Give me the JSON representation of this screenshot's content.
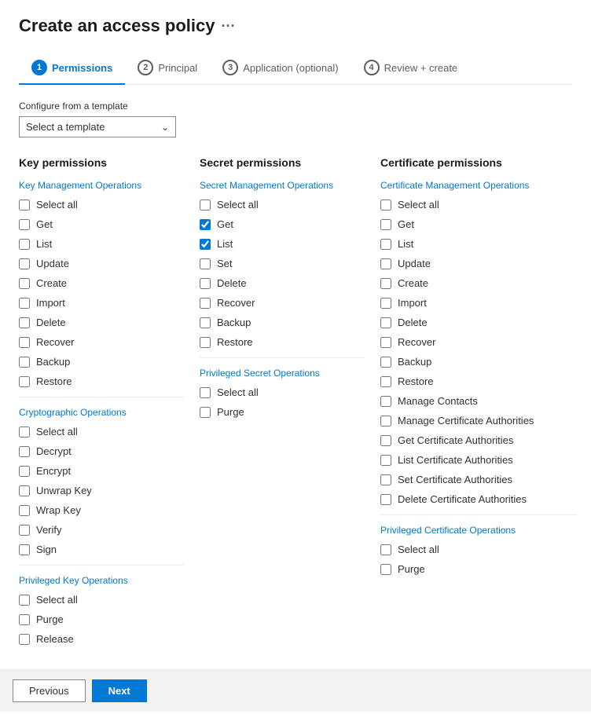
{
  "page": {
    "title": "Create an access policy",
    "title_ellipsis": "···"
  },
  "wizard": {
    "tabs": [
      {
        "id": "permissions",
        "step": "1",
        "label": "Permissions",
        "active": true
      },
      {
        "id": "principal",
        "step": "2",
        "label": "Principal",
        "active": false
      },
      {
        "id": "application",
        "step": "3",
        "label": "Application (optional)",
        "active": false
      },
      {
        "id": "review",
        "step": "4",
        "label": "Review + create",
        "active": false
      }
    ]
  },
  "template": {
    "label": "Configure from a template",
    "placeholder": "Select a template",
    "value": ""
  },
  "key_permissions": {
    "header": "Key permissions",
    "sections": [
      {
        "title": "Key Management Operations",
        "items": [
          {
            "id": "key-select-all",
            "label": "Select all",
            "checked": false
          },
          {
            "id": "key-get",
            "label": "Get",
            "checked": false
          },
          {
            "id": "key-list",
            "label": "List",
            "checked": false
          },
          {
            "id": "key-update",
            "label": "Update",
            "checked": false
          },
          {
            "id": "key-create",
            "label": "Create",
            "checked": false
          },
          {
            "id": "key-import",
            "label": "Import",
            "checked": false
          },
          {
            "id": "key-delete",
            "label": "Delete",
            "checked": false
          },
          {
            "id": "key-recover",
            "label": "Recover",
            "checked": false
          },
          {
            "id": "key-backup",
            "label": "Backup",
            "checked": false
          },
          {
            "id": "key-restore",
            "label": "Restore",
            "checked": false
          }
        ]
      },
      {
        "title": "Cryptographic Operations",
        "items": [
          {
            "id": "key-crypto-select-all",
            "label": "Select all",
            "checked": false
          },
          {
            "id": "key-decrypt",
            "label": "Decrypt",
            "checked": false
          },
          {
            "id": "key-encrypt",
            "label": "Encrypt",
            "checked": false
          },
          {
            "id": "key-unwrap",
            "label": "Unwrap Key",
            "checked": false
          },
          {
            "id": "key-wrap",
            "label": "Wrap Key",
            "checked": false
          },
          {
            "id": "key-verify",
            "label": "Verify",
            "checked": false
          },
          {
            "id": "key-sign",
            "label": "Sign",
            "checked": false
          }
        ]
      },
      {
        "title": "Privileged Key Operations",
        "items": [
          {
            "id": "key-priv-select-all",
            "label": "Select all",
            "checked": false
          },
          {
            "id": "key-purge",
            "label": "Purge",
            "checked": false
          },
          {
            "id": "key-release",
            "label": "Release",
            "checked": false
          }
        ]
      }
    ]
  },
  "secret_permissions": {
    "header": "Secret permissions",
    "sections": [
      {
        "title": "Secret Management Operations",
        "items": [
          {
            "id": "sec-select-all",
            "label": "Select all",
            "checked": false
          },
          {
            "id": "sec-get",
            "label": "Get",
            "checked": true
          },
          {
            "id": "sec-list",
            "label": "List",
            "checked": true
          },
          {
            "id": "sec-set",
            "label": "Set",
            "checked": false
          },
          {
            "id": "sec-delete",
            "label": "Delete",
            "checked": false
          },
          {
            "id": "sec-recover",
            "label": "Recover",
            "checked": false
          },
          {
            "id": "sec-backup",
            "label": "Backup",
            "checked": false
          },
          {
            "id": "sec-restore",
            "label": "Restore",
            "checked": false
          }
        ]
      },
      {
        "title": "Privileged Secret Operations",
        "items": [
          {
            "id": "sec-priv-select-all",
            "label": "Select all",
            "checked": false
          },
          {
            "id": "sec-purge",
            "label": "Purge",
            "checked": false
          }
        ]
      }
    ]
  },
  "certificate_permissions": {
    "header": "Certificate permissions",
    "sections": [
      {
        "title": "Certificate Management Operations",
        "items": [
          {
            "id": "cert-select-all",
            "label": "Select all",
            "checked": false
          },
          {
            "id": "cert-get",
            "label": "Get",
            "checked": false
          },
          {
            "id": "cert-list",
            "label": "List",
            "checked": false
          },
          {
            "id": "cert-update",
            "label": "Update",
            "checked": false
          },
          {
            "id": "cert-create",
            "label": "Create",
            "checked": false
          },
          {
            "id": "cert-import",
            "label": "Import",
            "checked": false
          },
          {
            "id": "cert-delete",
            "label": "Delete",
            "checked": false
          },
          {
            "id": "cert-recover",
            "label": "Recover",
            "checked": false
          },
          {
            "id": "cert-backup",
            "label": "Backup",
            "checked": false
          },
          {
            "id": "cert-restore",
            "label": "Restore",
            "checked": false
          },
          {
            "id": "cert-manage-contacts",
            "label": "Manage Contacts",
            "checked": false
          },
          {
            "id": "cert-manage-ca",
            "label": "Manage Certificate Authorities",
            "checked": false
          },
          {
            "id": "cert-get-ca",
            "label": "Get Certificate Authorities",
            "checked": false
          },
          {
            "id": "cert-list-ca",
            "label": "List Certificate Authorities",
            "checked": false
          },
          {
            "id": "cert-set-ca",
            "label": "Set Certificate Authorities",
            "checked": false
          },
          {
            "id": "cert-delete-ca",
            "label": "Delete Certificate Authorities",
            "checked": false
          }
        ]
      },
      {
        "title": "Privileged Certificate Operations",
        "items": [
          {
            "id": "cert-priv-select-all",
            "label": "Select all",
            "checked": false
          },
          {
            "id": "cert-purge",
            "label": "Purge",
            "checked": false
          }
        ]
      }
    ]
  },
  "footer": {
    "previous_label": "Previous",
    "next_label": "Next"
  }
}
